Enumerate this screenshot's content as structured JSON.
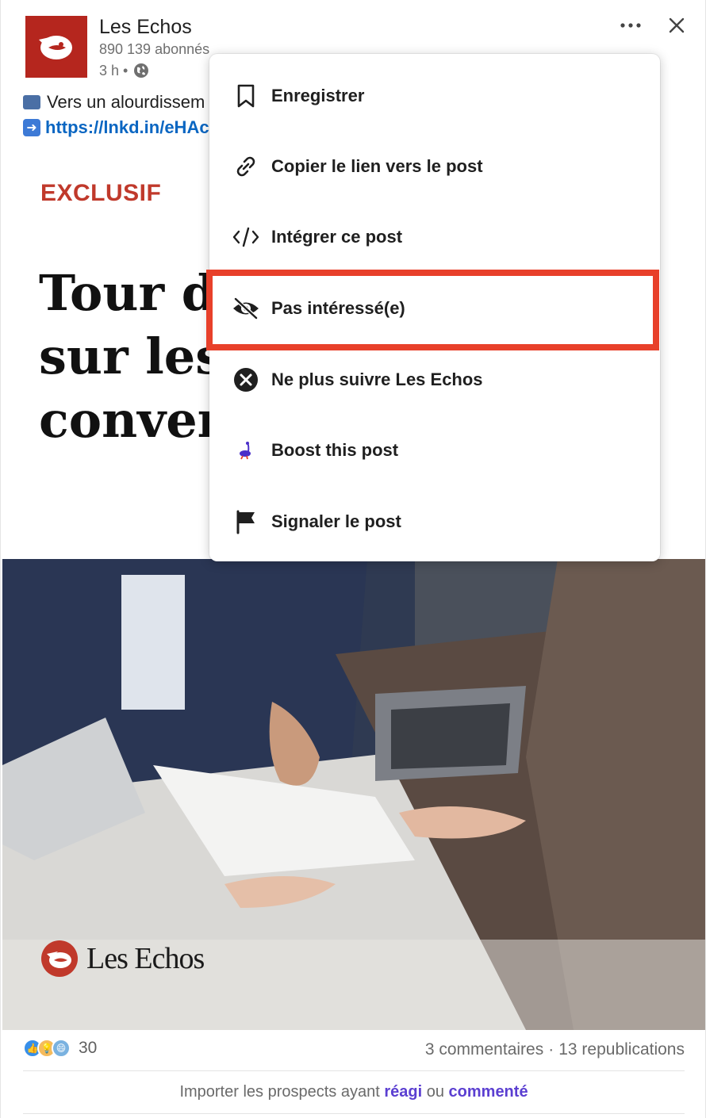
{
  "post": {
    "author": "Les Echos",
    "followers": "890 139 abonnés",
    "time": "3 h •",
    "text_line1": "Vers un alourdissem",
    "link": "https://lnkd.in/eHAc",
    "article": {
      "tag": "EXCLUSIF",
      "headline": "Tour de\nsur les\nconven"
    },
    "photo_brand": "Les Echos"
  },
  "menu": {
    "items": [
      {
        "label": "Enregistrer",
        "icon": "bookmark-icon"
      },
      {
        "label": "Copier le lien vers le post",
        "icon": "link-icon"
      },
      {
        "label": "Intégrer ce post",
        "icon": "code-icon"
      },
      {
        "label": "Pas intéressé(e)",
        "icon": "eye-slash-icon"
      },
      {
        "label": "Ne plus suivre Les Echos",
        "icon": "x-circle-icon"
      },
      {
        "label": "Boost this post",
        "icon": "ostrich-icon"
      },
      {
        "label": "Signaler le post",
        "icon": "flag-icon"
      }
    ],
    "highlighted": "Pas intéressé(e)"
  },
  "footer": {
    "reaction_count": "30",
    "comments": "3 commentaires",
    "separator": "·",
    "reposts": "13 republications",
    "import_prefix": "Importer les prospects ayant",
    "import_reacted": "réagi",
    "import_or": "ou",
    "import_commented": "commenté"
  },
  "colors": {
    "brand_red": "#b5261e",
    "link_blue": "#0a66c2",
    "highlight_red": "#e8402a",
    "accent_purple": "#5b3fd1"
  }
}
